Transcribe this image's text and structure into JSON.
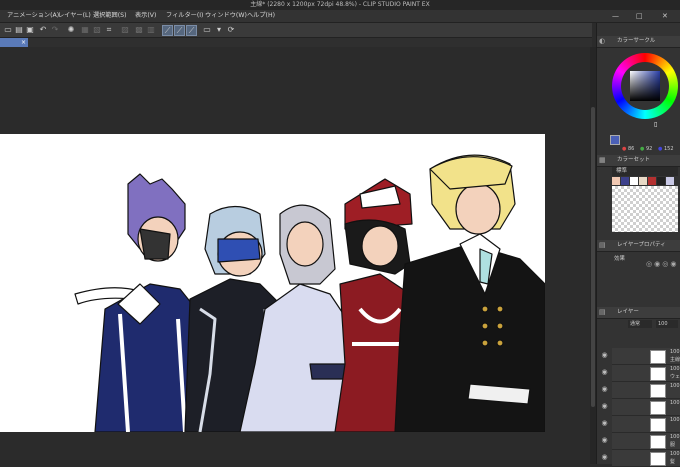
{
  "window": {
    "title": "主線* (2280 x 1200px 72dpi 48.8%) - CLIP STUDIO PAINT EX"
  },
  "menu": [
    {
      "label": "アニメーション(A)"
    },
    {
      "label": "レイヤー(L)"
    },
    {
      "label": "選択範囲(S)"
    },
    {
      "label": "表示(V)"
    },
    {
      "label": "フィルター(I)"
    },
    {
      "label": "ウィンドウ(W)"
    },
    {
      "label": "ヘルプ(H)"
    }
  ],
  "window_controls": {
    "minimize": "—",
    "maximize": "□",
    "close": "✕"
  },
  "document_tab": {
    "close": "×"
  },
  "panels": {
    "color_circle": {
      "title": "カラーサークル",
      "values": {
        "h": "86",
        "s": "92",
        "v": "152"
      }
    },
    "color_set": {
      "title": "カラーセット",
      "set_name": "標準"
    },
    "layer_property": {
      "title": "レイヤープロパティ",
      "effect_label": "効果"
    },
    "layer": {
      "title": "レイヤー",
      "blend_mode": "通常",
      "opacity": "100"
    }
  },
  "layers": [
    {
      "pct": "100",
      "name": "主線"
    },
    {
      "pct": "100",
      "name": "ウェ"
    },
    {
      "pct": "100",
      "name": ""
    },
    {
      "pct": "100",
      "name": ""
    },
    {
      "pct": "100",
      "name": ""
    },
    {
      "pct": "100",
      "name": "服"
    },
    {
      "pct": "100",
      "name": "髪"
    }
  ],
  "colors": {
    "accent": "#5a7ab8",
    "main_color": "#4a5fb5",
    "swatches": [
      "#f1c9b3",
      "#3b3f8a",
      "#ffffff",
      "#e8d9c6",
      "#b33030",
      "#222222",
      "#c9c9e6"
    ]
  },
  "icons": {
    "toolbar": [
      "new-icon",
      "open-icon",
      "save-icon",
      "undo-icon",
      "redo-icon",
      "settings-icon",
      "transform-icon",
      "crop-icon",
      "pen-icon",
      "pen-icon",
      "pen-icon",
      "view-icon",
      "rotate-icon"
    ]
  }
}
